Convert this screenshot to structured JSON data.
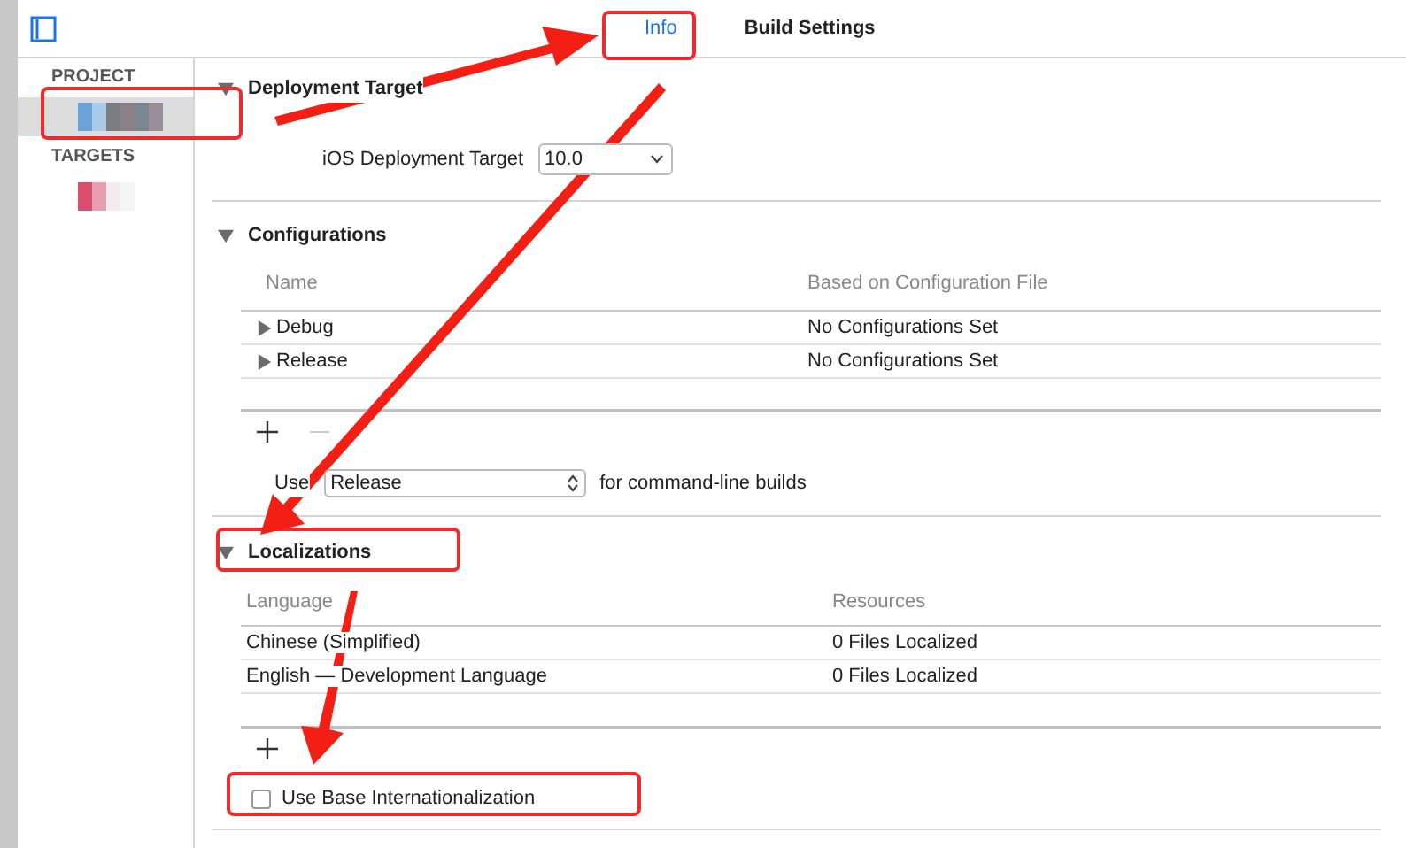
{
  "tabs": [
    {
      "label": "Info",
      "selected": true
    },
    {
      "label": "Build Settings",
      "selected": false
    }
  ],
  "sidebar": {
    "sections": [
      {
        "title": "PROJECT",
        "item_selected": true
      },
      {
        "title": "TARGETS",
        "item_selected": false
      }
    ]
  },
  "deployment": {
    "title": "Deployment Target",
    "expanded": true,
    "label": "iOS Deployment Target",
    "value": "10.0"
  },
  "configurations": {
    "title": "Configurations",
    "expanded": true,
    "columns": [
      "Name",
      "Based on Configuration File"
    ],
    "rows": [
      {
        "name": "Debug",
        "file": "No Configurations Set",
        "expanded": false
      },
      {
        "name": "Release",
        "file": "No Configurations Set",
        "expanded": false
      }
    ],
    "command_line": {
      "prefix": "Use",
      "value": "Release",
      "suffix": "for command-line builds"
    }
  },
  "localizations": {
    "title": "Localizations",
    "expanded": true,
    "columns": [
      "Language",
      "Resources"
    ],
    "rows": [
      {
        "language": "Chinese (Simplified)",
        "resources": "0 Files Localized"
      },
      {
        "language": "English — Development Language",
        "resources": "0 Files Localized"
      }
    ],
    "base_internationalization": {
      "label": "Use Base Internationalization",
      "checked": false
    }
  }
}
